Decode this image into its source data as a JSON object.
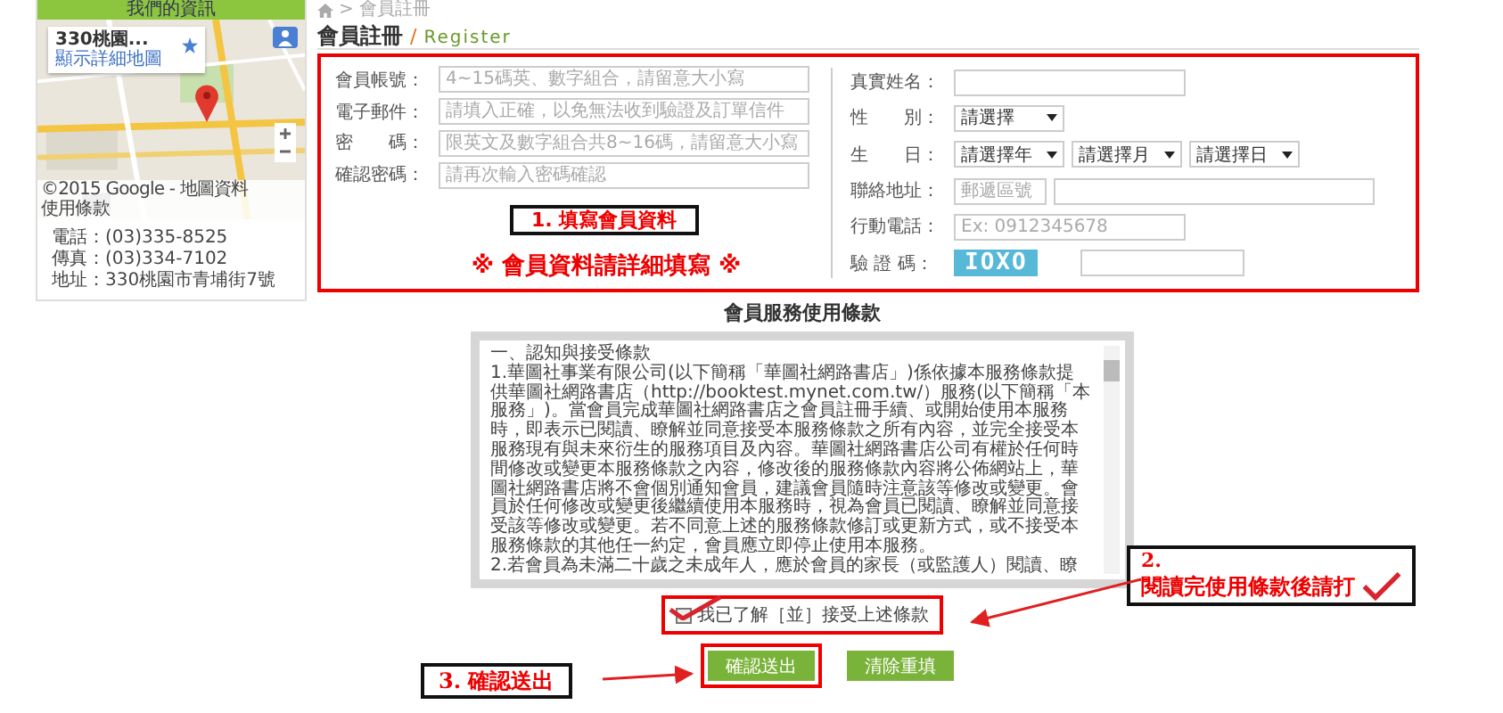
{
  "sidebar": {
    "heading": "我們的資訊",
    "map": {
      "kind": "picture",
      "place_name": "330桃園...",
      "details_link": "顯示詳細地圖",
      "attribution": "©2015 Google - 地圖資料",
      "terms_link": "使用條款"
    },
    "contacts": [
      "電話：(03)335-8525",
      "傳真：(03)334-7102",
      "地址：330桃園市青埔街7號"
    ]
  },
  "breadcrumb": {
    "separator": ">",
    "current": "會員註冊"
  },
  "page_title": {
    "title": "會員註冊",
    "separator": "/",
    "subtitle": "Register"
  },
  "form": {
    "left_fields": [
      {
        "kind": "text",
        "label": "會員帳號：",
        "placeholder": "4~15碼英、數字組合，請留意大小寫"
      },
      {
        "kind": "text",
        "label": "電子郵件：",
        "placeholder": "請填入正確，以免無法收到驗證及訂單信件"
      },
      {
        "kind": "text",
        "label": "密　　碼：",
        "placeholder": "限英文及數字組合共8~16碼，請留意大小寫"
      },
      {
        "kind": "text",
        "label": "確認密碼：",
        "placeholder": "請再次輸入密碼確認"
      }
    ],
    "right_fields": [
      {
        "kind": "text",
        "label": "真實姓名："
      },
      {
        "kind": "select",
        "label": "性　　別：",
        "values": [
          "請選擇"
        ]
      },
      {
        "kind": "select",
        "label": "生　　日：",
        "values": [
          "請選擇年",
          "請選擇月",
          "請選擇日"
        ]
      },
      {
        "kind": "address",
        "label": "聯絡地址：",
        "placeholder": "郵遞區號"
      },
      {
        "kind": "text",
        "label": "行動電話：",
        "placeholder": "Ex: 0912345678"
      },
      {
        "kind": "captcha",
        "label": "驗 證 碼：",
        "captcha": "IOXO"
      }
    ]
  },
  "annotations": {
    "step_1": "1. 填寫會員資料",
    "fill_note": "※ 會員資料請詳細填寫 ※",
    "step_2_number": "2.",
    "step_2_text": "閱讀完使用條款後請打",
    "step_3": "3. 確認送出"
  },
  "terms": {
    "title": "會員服務使用條款",
    "heading": "一、認知與接受條款",
    "paragraphs": [
      "1.華圖社事業有限公司(以下簡稱「華圖社網路書店」)係依據本服務條款提供華圖社網路書店（http://booktest.mynet.com.tw/）服務(以下簡稱「本服務」)。當會員完成華圖社網路書店之會員註冊手續、或開始使用本服務時，即表示已閱讀、瞭解並同意接受本服務條款之所有內容，並完全接受本服務現有與未來衍生的服務項目及內容。華圖社網路書店公司有權於任何時間修改或變更本服務條款之內容，修改後的服務條款內容將公佈網站上，華圖社網路書店將不會個別通知會員，建議會員隨時注意該等修改或變更。會員於任何修改或變更後繼續使用本服務時，視為會員已閱讀、瞭解並同意接受該等修改或變更。若不同意上述的服務條款修訂或更新方式，或不接受本服務條款的其他任一約定，會員應立即停止使用本服務。",
      "2.若會員為未滿二十歲之未成年人，應於會員的家長（或監護人）閱讀、瞭"
    ]
  },
  "agree": {
    "label": "我已了解［並］接受上述條款",
    "checked": true
  },
  "buttons": [
    {
      "label": "確認送出",
      "highlighted": true
    },
    {
      "label": "清除重填",
      "highlighted": false
    }
  ]
}
